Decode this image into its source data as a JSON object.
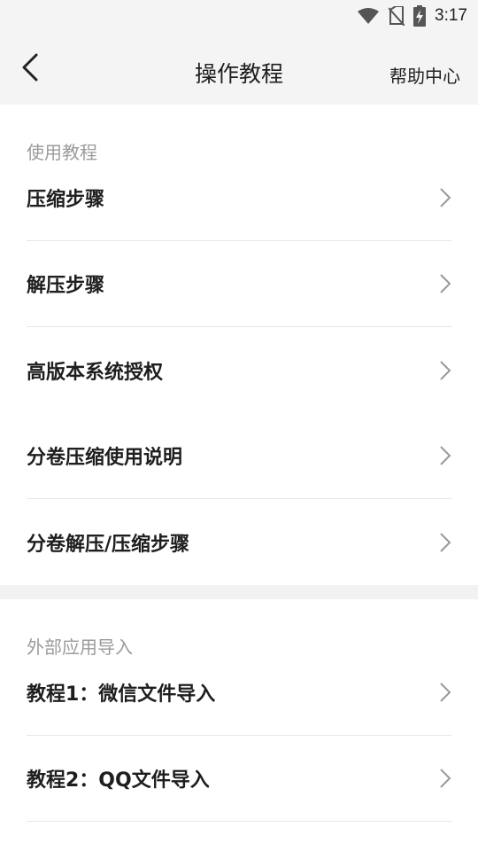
{
  "status": {
    "time": "3:17"
  },
  "header": {
    "title": "操作教程",
    "help": "帮助中心"
  },
  "sections": [
    {
      "title": "使用教程",
      "items": [
        "压缩步骤",
        "解压步骤",
        "高版本系统授权",
        "分卷压缩使用说明",
        "分卷解压/压缩步骤"
      ]
    },
    {
      "title": "外部应用导入",
      "items": [
        "教程1：微信文件导入",
        "教程2：QQ文件导入"
      ]
    }
  ],
  "colors": {
    "background": "#ffffff",
    "header_bg": "#f4f4f4",
    "section_title": "#9b9b9b",
    "separator": "#e7e7e7"
  },
  "icons": {
    "back": "chevron-left-icon",
    "row": "chevron-right-icon"
  }
}
